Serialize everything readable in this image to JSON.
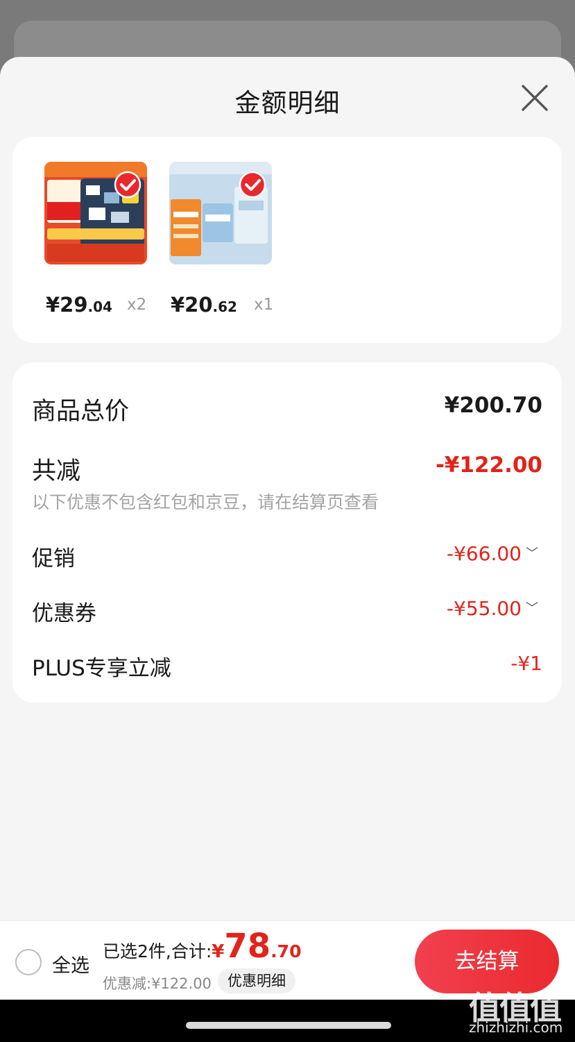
{
  "sheet": {
    "title": "金额明细",
    "close_icon": "close-icon"
  },
  "products": [
    {
      "price_int": "¥29",
      "price_dec": ".04",
      "qty": "x2",
      "selected": true
    },
    {
      "price_int": "¥20",
      "price_dec": ".62",
      "qty": "x1",
      "selected": true
    }
  ],
  "detail": {
    "total_label": "商品总价",
    "total_value": "¥200.70",
    "reduce_label": "共减",
    "reduce_value": "-¥122.00",
    "note": "以下优惠不包含红包和京豆，请在结算页查看",
    "promo_label": "促销",
    "promo_value": "-¥66.00",
    "coupon_label": "优惠券",
    "coupon_value": "-¥55.00",
    "plus_label": "PLUS专享立减",
    "plus_value": "-¥1"
  },
  "bottom": {
    "select_all": "全选",
    "selected_text": "已选2件,合计:",
    "total_symbol": "¥",
    "total_int": "78",
    "total_dec": ".70",
    "discount": "优惠减:¥122.00",
    "detail_chip": "优惠明细",
    "checkout": "去结算"
  },
  "watermark": {
    "glyphs": "值值值",
    "domain": "zhizhizhi.com"
  },
  "colors": {
    "accent": "#e2231a",
    "overlay": "#7a7a7a",
    "sheet_bg": "#f5f5f5"
  }
}
